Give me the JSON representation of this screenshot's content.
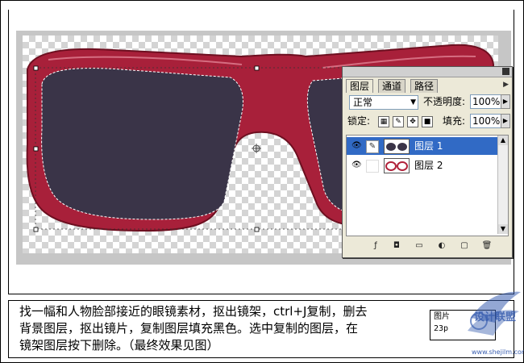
{
  "panel": {
    "tabs": [
      "图层",
      "通道",
      "路径"
    ],
    "menu_icon": "panel-menu-arrow-icon",
    "blend_mode": "正常",
    "opacity_label": "不透明度:",
    "opacity_value": "100%",
    "lock_label": "锁定:",
    "fill_label": "填充:",
    "fill_value": "100%",
    "layers": [
      {
        "name": "图层 1",
        "selected": true
      },
      {
        "name": "图层 2",
        "selected": false
      }
    ],
    "bottom_icons": [
      "link-layers-icon",
      "layer-style-icon",
      "layer-mask-icon",
      "new-group-icon",
      "adjustment-layer-icon",
      "new-layer-icon",
      "delete-layer-icon"
    ]
  },
  "caption": {
    "line1": "找一幅和人物脸部接近的眼镜素材，抠出镜架，ctrl+J复制，删去",
    "line2": "背景图层，抠出镜片，复制图层填充黑色。选中复制的图层，在",
    "line3": "镜架图层按下删除。（最终效果见图）"
  },
  "info": {
    "line1": "图片",
    "line2": "23p"
  },
  "watermark": {
    "text": "设计联盟",
    "url": "www.shejilm.com"
  },
  "colors": {
    "frame_red": "#b0223a",
    "lens": "#3a3448",
    "selection": "#316ac5",
    "canvas_gray": "#c6c6c6"
  }
}
